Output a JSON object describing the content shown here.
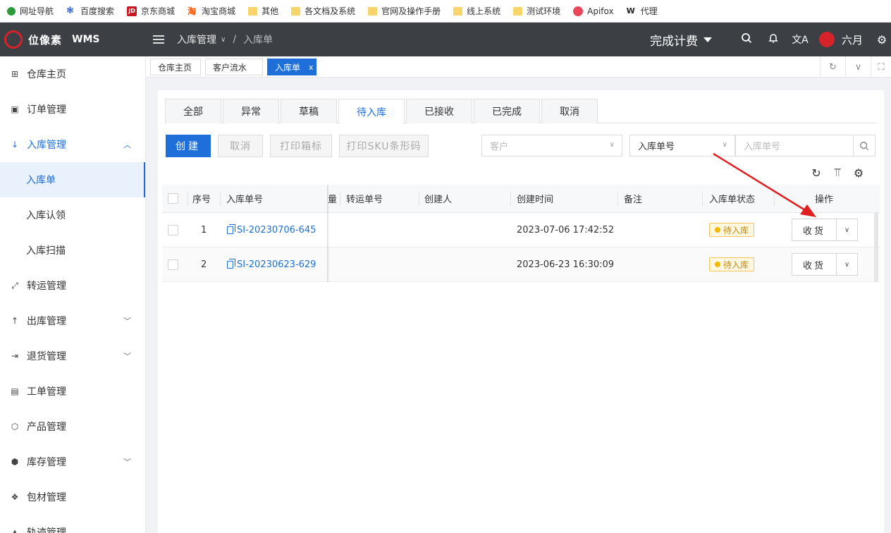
{
  "bookmarks": [
    {
      "label": "网址导航",
      "icon": "hao-icon",
      "color": "#2e9b3a"
    },
    {
      "label": "百度搜索",
      "icon": "baidu-paw-icon",
      "color": "#2a59d3"
    },
    {
      "label": "京东商城",
      "icon": "jd-icon",
      "color": "#c91623"
    },
    {
      "label": "淘宝商城",
      "icon": "taobao-icon",
      "color": "#ff5000"
    },
    {
      "label": "其他",
      "icon": "folder-icon",
      "color": "#f7d56a"
    },
    {
      "label": "各文档及系统",
      "icon": "folder-icon",
      "color": "#f7d56a"
    },
    {
      "label": "官网及操作手册",
      "icon": "folder-icon",
      "color": "#f7d56a"
    },
    {
      "label": "线上系统",
      "icon": "folder-icon",
      "color": "#f7d56a"
    },
    {
      "label": "测试环境",
      "icon": "folder-icon",
      "color": "#f7d56a"
    },
    {
      "label": "Apifox",
      "icon": "apifox-icon",
      "color": "#e8485a"
    },
    {
      "label": "代理",
      "icon": "w-logo-icon",
      "color": "#222222"
    }
  ],
  "header": {
    "logo_text": "位像素",
    "logo_sub": "WMS",
    "breadcrumb": {
      "parent": "入库管理",
      "current": "入库单",
      "sep": "/"
    },
    "billing": "完成计费",
    "user": "六月"
  },
  "sidebar": {
    "items": [
      {
        "label": "仓库主页",
        "icon": "grid-icon"
      },
      {
        "label": "订单管理",
        "icon": "order-icon"
      },
      {
        "label": "入库管理",
        "icon": "arrow-down-icon",
        "open": true
      },
      {
        "label": "入库单",
        "sub": true,
        "active": true
      },
      {
        "label": "入库认领",
        "sub": true
      },
      {
        "label": "入库扫描",
        "sub": true
      },
      {
        "label": "转运管理",
        "icon": "transfer-icon"
      },
      {
        "label": "出库管理",
        "icon": "arrow-up-icon",
        "chev": true
      },
      {
        "label": "退货管理",
        "icon": "return-icon",
        "chev": true
      },
      {
        "label": "工单管理",
        "icon": "workorder-icon"
      },
      {
        "label": "产品管理",
        "icon": "product-icon"
      },
      {
        "label": "库存管理",
        "icon": "inventory-icon",
        "chev": true
      },
      {
        "label": "包材管理",
        "icon": "package-icon"
      },
      {
        "label": "轨迹管理",
        "icon": "track-icon"
      }
    ]
  },
  "page_tabs": [
    {
      "label": "仓库主页"
    },
    {
      "label": "客户流水"
    },
    {
      "label": "入库单",
      "active": true,
      "close": "x"
    }
  ],
  "status_tabs": [
    "全部",
    "异常",
    "草稿",
    "待入库",
    "已接收",
    "已完成",
    "取消"
  ],
  "active_status_tab": "待入库",
  "toolbar": {
    "create": "创建",
    "cancel": "取消",
    "print_box": "打印箱标",
    "print_sku": "打印SKU条形码",
    "customer_placeholder": "客户",
    "search_type": "入库单号",
    "search_placeholder": "入库单号"
  },
  "table": {
    "headers": [
      "序号",
      "入库单号",
      "量",
      "转运单号",
      "创建人",
      "创建时间",
      "备注",
      "入库单状态",
      "操作"
    ],
    "rows": [
      {
        "index": "1",
        "order_no": "SI-20230706-645",
        "created": "2023-07-06 17:42:52",
        "status": "待入库",
        "action": "收货"
      },
      {
        "index": "2",
        "order_no": "SI-20230623-629",
        "created": "2023-06-23 16:30:09",
        "status": "待入库",
        "action": "收货"
      }
    ]
  },
  "colors": {
    "primary": "#1e6fd9",
    "header_bg": "#3c3f44",
    "annotation_arrow": "#e02020",
    "status_pending": "#f5b800"
  }
}
